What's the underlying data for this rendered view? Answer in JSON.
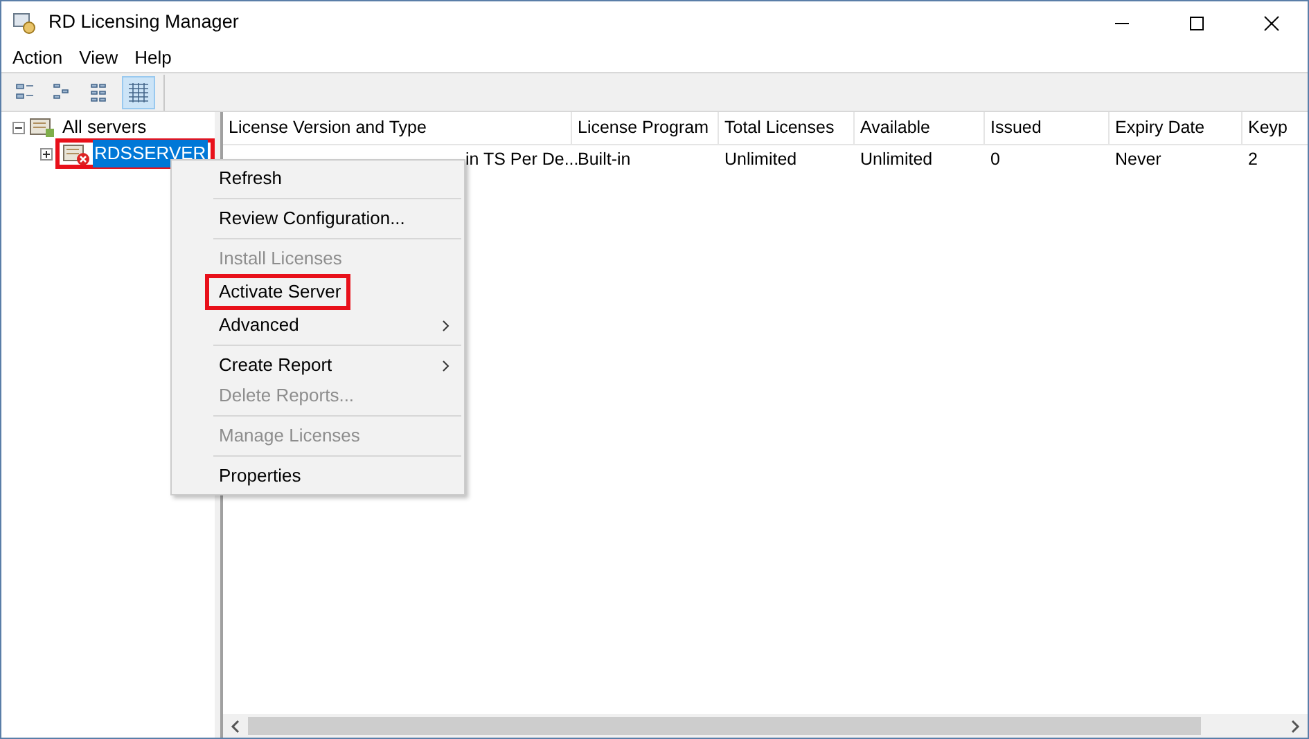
{
  "window": {
    "title": "RD Licensing Manager"
  },
  "menu_bar": [
    "Action",
    "View",
    "Help"
  ],
  "toolbar": [
    {
      "selected": false
    },
    {
      "selected": false
    },
    {
      "selected": false
    },
    {
      "selected": true
    }
  ],
  "tree": [
    {
      "label": "All servers",
      "expanded": true,
      "children": [
        {
          "label": "RDSSERVER",
          "selected": true,
          "highlighted": true,
          "expanded": false
        }
      ]
    }
  ],
  "table": {
    "columns": [
      "License Version and Type",
      "License Program",
      "Total Licenses",
      "Available",
      "Issued",
      "Expiry Date",
      "Keyp"
    ],
    "rows": [
      [
        "in TS Per De...",
        "Built-in",
        "Unlimited",
        "Unlimited",
        "0",
        "Never",
        "2"
      ]
    ]
  },
  "context_menu": [
    {
      "label": "Refresh",
      "disabled": false,
      "highlighted": false,
      "submenu": false,
      "divider_after": true
    },
    {
      "label": "Review Configuration...",
      "disabled": false,
      "highlighted": false,
      "submenu": false,
      "divider_after": true
    },
    {
      "label": "Install Licenses",
      "disabled": true,
      "highlighted": false,
      "submenu": false,
      "divider_after": false
    },
    {
      "label": "Activate Server",
      "disabled": false,
      "highlighted": true,
      "submenu": false,
      "divider_after": false
    },
    {
      "label": "Advanced",
      "disabled": false,
      "highlighted": false,
      "submenu": true,
      "divider_after": true
    },
    {
      "label": "Create Report",
      "disabled": false,
      "highlighted": false,
      "submenu": true,
      "divider_after": false
    },
    {
      "label": "Delete Reports...",
      "disabled": true,
      "highlighted": false,
      "submenu": false,
      "divider_after": true
    },
    {
      "label": "Manage Licenses",
      "disabled": true,
      "highlighted": false,
      "submenu": false,
      "divider_after": true
    },
    {
      "label": "Properties",
      "disabled": false,
      "highlighted": false,
      "submenu": false,
      "divider_after": false
    }
  ]
}
